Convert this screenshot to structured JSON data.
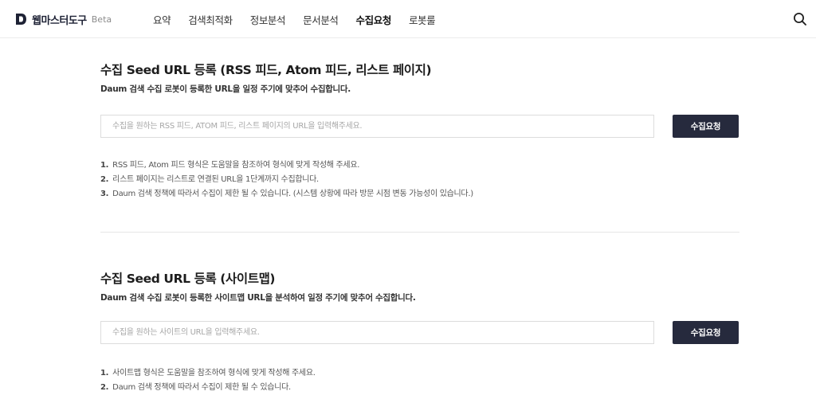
{
  "header": {
    "logo_text": "웹마스터도구",
    "logo_beta": "Beta",
    "nav": [
      {
        "label": "요약",
        "active": false
      },
      {
        "label": "검색최적화",
        "active": false
      },
      {
        "label": "정보분석",
        "active": false
      },
      {
        "label": "문서분석",
        "active": false
      },
      {
        "label": "수집요청",
        "active": true
      },
      {
        "label": "로봇룰",
        "active": false
      }
    ],
    "search_icon": "search-icon"
  },
  "rss_section": {
    "title": "수집 Seed URL 등록 (RSS 피드, Atom 피드, 리스트 페이지)",
    "description": "Daum 검색 수집 로봇이 등록한 URL을 일정 주기에 맞추어 수집합니다.",
    "input_placeholder": "수집을 원하는 RSS 피드, ATOM 피드, 리스트 페이지의 URL을 입력해주세요.",
    "input_value": "",
    "button_label": "수집요청",
    "notes": [
      {
        "num": "1.",
        "text": "RSS 피드, Atom 피드 형식은 도움말을 참조하여 형식에 맞게 작성해 주세요."
      },
      {
        "num": "2.",
        "text": "리스트 페이지는 리스트로 연결된 URL을 1단계까지 수집합니다."
      },
      {
        "num": "3.",
        "text": "Daum 검색 정책에 따라서 수집이 제한 될 수 있습니다. (시스템 상황에 따라 방문 시점 변동 가능성이 있습니다.)"
      }
    ]
  },
  "sitemap_section": {
    "title": "수집 Seed URL 등록 (사이트맵)",
    "description": "Daum 검색 수집 로봇이 등록한 사이트맵 URL을 분석하여 일정 주기에 맞추어 수집합니다.",
    "input_placeholder": "수집을 원하는 사이트의 URL을 입력해주세요.",
    "input_value": "",
    "button_label": "수집요청",
    "notes": [
      {
        "num": "1.",
        "text": "사이트맵 형식은 도움말을 참조하여 형식에 맞게 작성해 주세요."
      },
      {
        "num": "2.",
        "text": "Daum 검색 정책에 따라서 수집이 제한 될 수 있습니다."
      }
    ]
  },
  "colors": {
    "brand": "#1e2235",
    "button_bg": "#262a3d",
    "button_text": "#ffffff",
    "border": "#dcdcdc",
    "divider": "#e6e6e6"
  }
}
